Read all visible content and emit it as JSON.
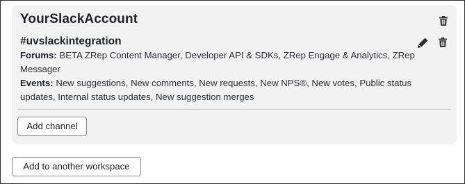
{
  "workspace": {
    "name": "YourSlackAccount",
    "channel": {
      "name": "#uvslackintegration",
      "forums_label": "Forums:",
      "forums_value": "BETA ZRep Content Manager, Developer API & SDKs, ZRep Engage & Analytics, ZRep Messager",
      "events_label": "Events:",
      "events_value": "New suggestions, New comments, New requests, New NPS®, New votes, Public status updates, Internal status updates, New suggestion merges"
    },
    "add_channel_label": "Add channel"
  },
  "add_workspace_label": "Add to another workspace",
  "icons": {
    "workspace_delete": "trash-icon",
    "channel_edit": "pencil-icon",
    "channel_delete": "trash-icon"
  }
}
